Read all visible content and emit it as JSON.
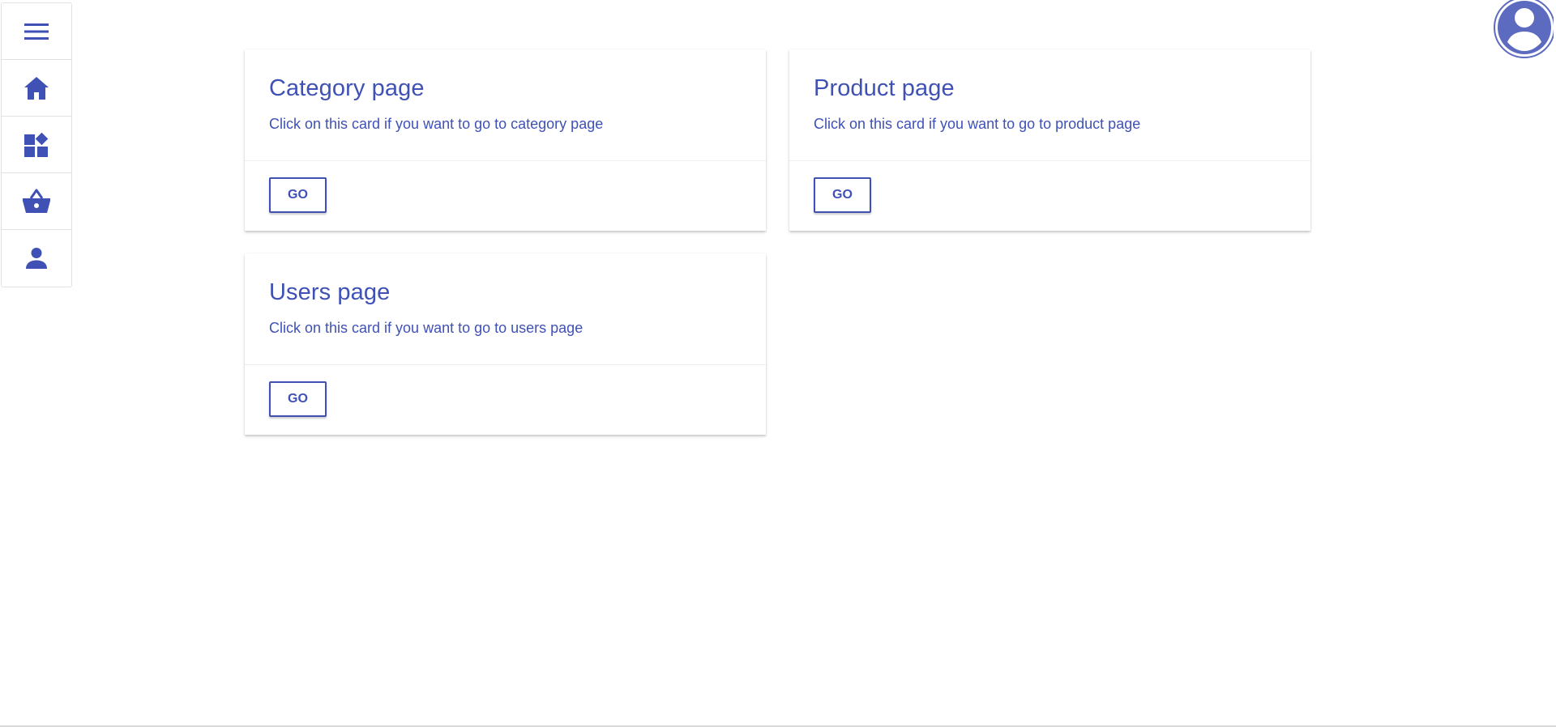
{
  "colors": {
    "accent": "#3f51b5",
    "border": "#e2e2e2",
    "background": "#ffffff"
  },
  "sidebar": {
    "items": [
      {
        "icon": "menu-icon"
      },
      {
        "icon": "home-icon"
      },
      {
        "icon": "category-icon"
      },
      {
        "icon": "basket-icon"
      },
      {
        "icon": "person-icon"
      }
    ]
  },
  "header": {
    "avatar_icon": "account-circle-icon"
  },
  "cards": [
    {
      "title": "Category page",
      "text": "Click on this card if you want to go to category page",
      "button_label": "GO"
    },
    {
      "title": "Product page",
      "text": "Click on this card if you want to go to product page",
      "button_label": "GO"
    },
    {
      "title": "Users page",
      "text": "Click on this card if you want to go to users page",
      "button_label": "GO"
    }
  ]
}
